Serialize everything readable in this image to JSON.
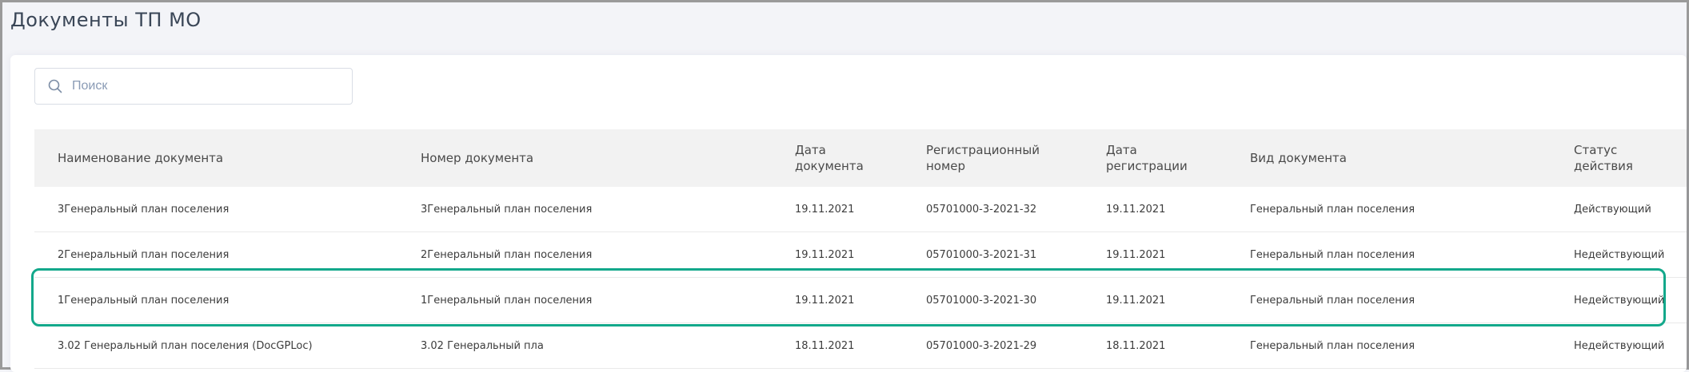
{
  "page": {
    "title": "Документы ТП МО"
  },
  "search": {
    "placeholder": "Поиск",
    "value": ""
  },
  "table": {
    "headers": [
      "Наименование документа",
      "Номер документа",
      "Дата документа",
      "Регистрационный номер",
      "Дата регистрации",
      "Вид документа",
      "Статус действия"
    ],
    "rows": [
      [
        "3Генеральный план поселения",
        "3Генеральный план поселения",
        "19.11.2021",
        "05701000-3-2021-32",
        "19.11.2021",
        "Генеральный план поселения",
        "Действующий"
      ],
      [
        "2Генеральный план поселения",
        "2Генеральный план поселения",
        "19.11.2021",
        "05701000-3-2021-31",
        "19.11.2021",
        "Генеральный план поселения",
        "Недействующий"
      ],
      [
        "1Генеральный план поселения",
        "1Генеральный план поселения",
        "19.11.2021",
        "05701000-3-2021-30",
        "19.11.2021",
        "Генеральный план поселения",
        "Недействующий"
      ],
      [
        "3.02 Генеральный план поселения (DocGPLoc)",
        "3.02 Генеральный пла",
        "18.11.2021",
        "05701000-3-2021-29",
        "18.11.2021",
        "Генеральный план поселения",
        "Недействующий"
      ]
    ]
  },
  "colors": {
    "highlight": "#13a88b",
    "header_bg": "#f2f2f2"
  },
  "icons": {
    "search": "search-icon"
  }
}
